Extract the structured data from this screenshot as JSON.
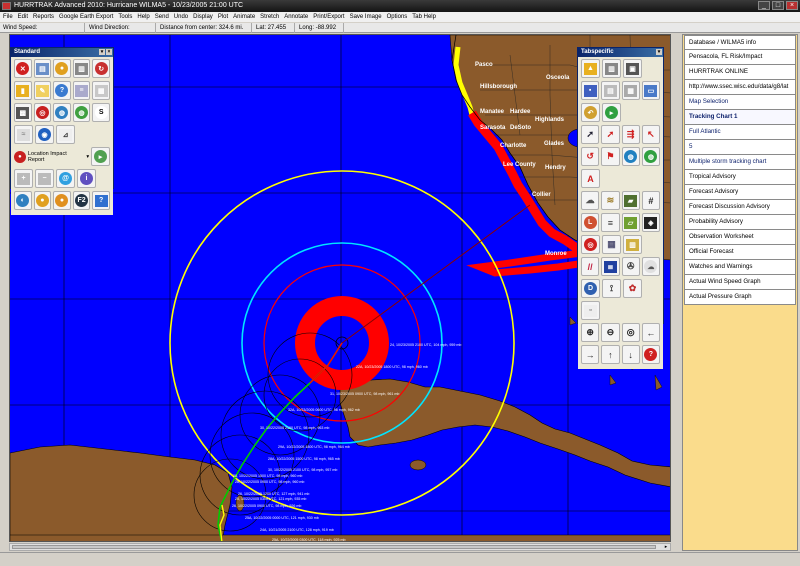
{
  "window": {
    "title": "HURRTRAK Advanced 2010: Hurricane WILMA5 - 10/23/2005 21:00 UTC"
  },
  "menu": [
    "File",
    "Edit",
    "Reports",
    "Google Earth Export",
    "Tools",
    "Help",
    "Send",
    "Undo",
    "Display",
    "Plot",
    "Animate",
    "Stretch",
    "Annotate",
    "Print/Export",
    "Save Image",
    "Options",
    "Tab Help"
  ],
  "info": {
    "wind_speed": "Wind Speed:",
    "wind_direction": "Wind Direction:",
    "distance": "Distance from center: 324.6 mi.",
    "lat": "Lat: 27.455",
    "long": "Long: -88.992"
  },
  "toolwindows": {
    "standard_title": "Standard",
    "location_report": "Location Impact Report",
    "tabspecific_title": "Tabspecific"
  },
  "map": {
    "places": [
      "Pasco",
      "Osceola",
      "Hillsborough",
      "Manatee",
      "Hardee",
      "Highlands",
      "Sarasota",
      "DeSoto",
      "Charlotte",
      "Glades",
      "Lee County",
      "Hendry",
      "Collier",
      "Monroe"
    ],
    "track_labels": [
      "24, 10/23/2005 2100 UTC, 104 mph, 959 mb",
      "22A, 10/23/2005 1800 UTC, 98 mph, 960 mb",
      "31, 10/23/2005 0900 UTC, 98 mph, 961 mb",
      "32A, 10/23/2005 0600 UTC, 98 mph, 962 mb",
      "30, 10/22/2005 2100 UTC, 98 mph, 963 mb",
      "29A, 10/22/2005 1800 UTC, 98 mph, 964 mb",
      "28A, 10/22/2005 1500 UTC, 98 mph, 965 mb",
      "30, 10/22/2005 2100 UTC, 98 mph, 957 mb",
      "28, 10/22/2005 1500 UTC, 98 mph, 960 mb",
      "28, 10/22/2005 0900 UTC, 98 mph, 960 mb",
      "26, 10/22/2005 1200 UTC, 127 mph, 941 mb",
      "25, 10/22/2005 0300 UTC, 121 mph, 935 mb",
      "26, 10/22/2005 0900 UTC, 98 mph, 926 mb",
      "25A, 10/22/2005 0000 UTC, 121 mph, 930 mb",
      "24A, 10/21/2005 2100 UTC, 128 mph, 919 mb",
      "25A, 10/22/2005 0300 UTC, 118 mph, 925 mb"
    ]
  },
  "side_panel": {
    "items": [
      "Database / WILMA5 info",
      "Pensacola, FL Risk/Impact",
      "HURRTRAK ONLINE",
      "http://www.ssec.wisc.edu/data/g8/lat",
      "Map Selection",
      "Tracking Chart 1",
      "Full Atlantic",
      "5",
      "Multiple storm tracking chart",
      "Tropical Advisory",
      "Forecast Advisory",
      "Forecast Discussion Advisory",
      "Probability Advisory",
      "Observation Worksheet",
      "Official Forecast",
      "Watches and Warnings",
      "Actual Wind Speed Graph",
      "Actual Pressure Graph"
    ]
  },
  "colors": {
    "ocean": "#0000ff",
    "land": "#8b5a2b",
    "hurricane_wind": "#ff0000",
    "ring_yellow": "#ffff00",
    "ring_cyan": "#00e5ff",
    "side_panel_bg": "#fadc8c"
  }
}
